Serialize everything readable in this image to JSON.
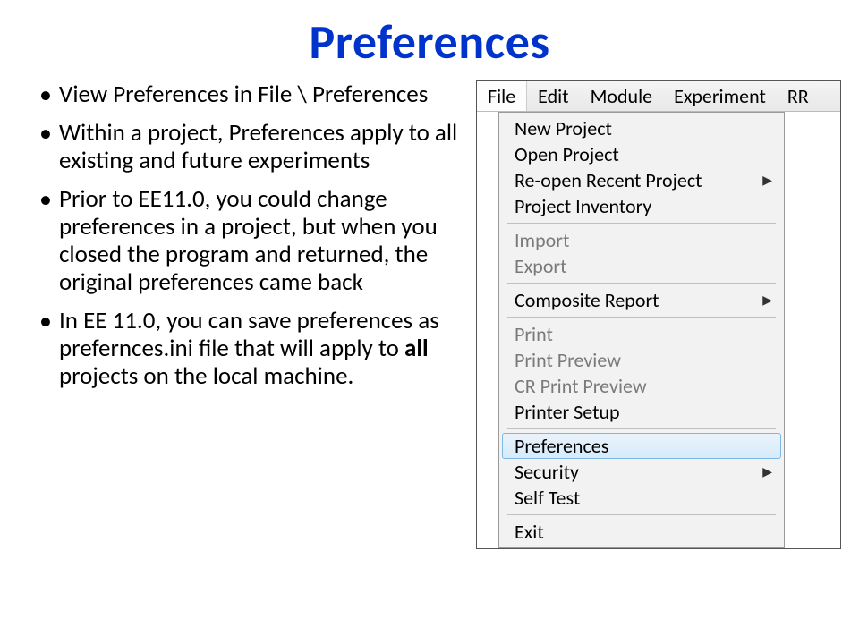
{
  "title": "Preferences",
  "bullets": [
    {
      "pre": "View Preferences in File \\ Preferences",
      "bold": "",
      "post": ""
    },
    {
      "pre": "Within a project, Preferences apply to all existing and future experiments",
      "bold": "",
      "post": ""
    },
    {
      "pre": "Prior to EE11.0, you could change preferences in a project, but when you closed the program and returned, the original preferences came back",
      "bold": "",
      "post": ""
    },
    {
      "pre": "In EE 11.0, you can save preferences as prefernces.ini file that will apply to ",
      "bold": "all",
      "post": " projects on the local machine."
    }
  ],
  "menubar": [
    {
      "label": "File",
      "active": true
    },
    {
      "label": "Edit",
      "active": false
    },
    {
      "label": "Module",
      "active": false
    },
    {
      "label": "Experiment",
      "active": false
    },
    {
      "label": "RR",
      "active": false
    }
  ],
  "dropdown": [
    {
      "type": "item",
      "label": "New Project"
    },
    {
      "type": "item",
      "label": "Open Project"
    },
    {
      "type": "item",
      "label": "Re-open Recent Project",
      "submenu": true
    },
    {
      "type": "item",
      "label": "Project Inventory"
    },
    {
      "type": "sep"
    },
    {
      "type": "item",
      "label": "Import",
      "disabled": true
    },
    {
      "type": "item",
      "label": "Export",
      "disabled": true
    },
    {
      "type": "sep"
    },
    {
      "type": "item",
      "label": "Composite Report",
      "submenu": true
    },
    {
      "type": "sep"
    },
    {
      "type": "item",
      "label": "Print",
      "disabled": true
    },
    {
      "type": "item",
      "label": "Print Preview",
      "disabled": true
    },
    {
      "type": "item",
      "label": "CR Print Preview",
      "disabled": true
    },
    {
      "type": "item",
      "label": "Printer Setup"
    },
    {
      "type": "sep"
    },
    {
      "type": "item",
      "label": "Preferences",
      "highlight": true
    },
    {
      "type": "item",
      "label": "Security",
      "submenu": true
    },
    {
      "type": "item",
      "label": "Self Test"
    },
    {
      "type": "sep"
    },
    {
      "type": "item",
      "label": "Exit"
    }
  ]
}
